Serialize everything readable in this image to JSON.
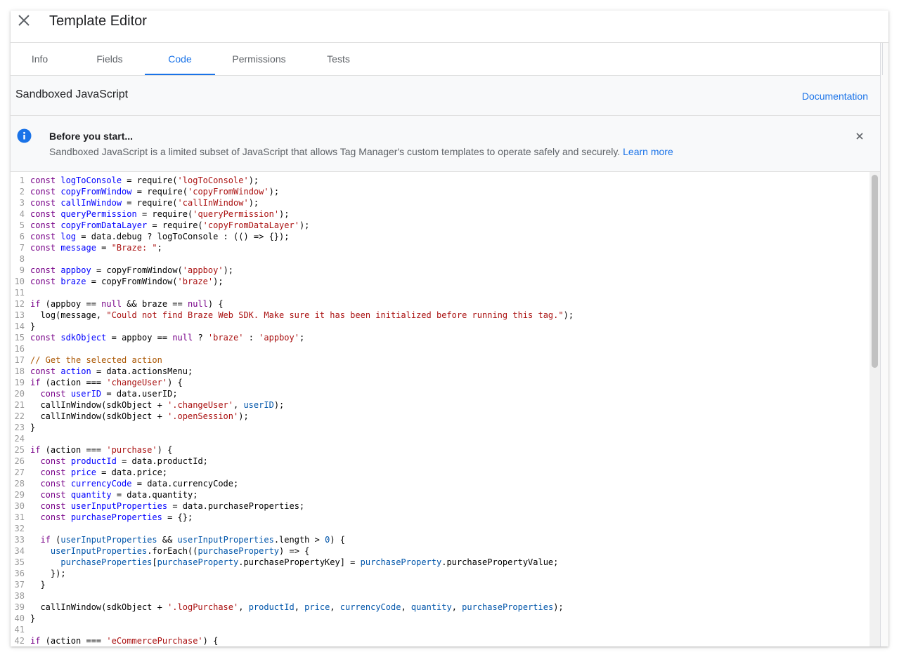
{
  "header": {
    "title": "Template Editor"
  },
  "tabs": [
    {
      "label": "Info",
      "active": false
    },
    {
      "label": "Fields",
      "active": false
    },
    {
      "label": "Code",
      "active": true
    },
    {
      "label": "Permissions",
      "active": false
    },
    {
      "label": "Tests",
      "active": false
    }
  ],
  "section": {
    "title": "Sandboxed JavaScript",
    "doc_link": "Documentation"
  },
  "notice": {
    "title": "Before you start...",
    "body": "Sandboxed JavaScript is a limited subset of JavaScript that allows Tag Manager's custom templates to operate safely and securely.",
    "learn_more": "Learn more"
  },
  "colors": {
    "accent": "#1a73e8",
    "keyword": "#770088",
    "def": "#0000ff",
    "string": "#aa1111",
    "comment": "#aa5500",
    "variable": "#0055aa"
  },
  "icons": {
    "close": "close-icon",
    "info": "info-icon",
    "dismiss": "close-icon"
  },
  "code": {
    "language": "javascript",
    "lines": [
      {
        "n": 1,
        "text": "const logToConsole = require('logToConsole');"
      },
      {
        "n": 2,
        "text": "const copyFromWindow = require('copyFromWindow');"
      },
      {
        "n": 3,
        "text": "const callInWindow = require('callInWindow');"
      },
      {
        "n": 4,
        "text": "const queryPermission = require('queryPermission');"
      },
      {
        "n": 5,
        "text": "const copyFromDataLayer = require('copyFromDataLayer');"
      },
      {
        "n": 6,
        "text": "const log = data.debug ? logToConsole : (() => {});"
      },
      {
        "n": 7,
        "text": "const message = \"Braze: \";"
      },
      {
        "n": 8,
        "text": ""
      },
      {
        "n": 9,
        "text": "const appboy = copyFromWindow('appboy');"
      },
      {
        "n": 10,
        "text": "const braze = copyFromWindow('braze');"
      },
      {
        "n": 11,
        "text": ""
      },
      {
        "n": 12,
        "text": "if (appboy == null && braze == null) {"
      },
      {
        "n": 13,
        "text": "  log(message, \"Could not find Braze Web SDK. Make sure it has been initialized before running this tag.\");"
      },
      {
        "n": 14,
        "text": "}"
      },
      {
        "n": 15,
        "text": "const sdkObject = appboy == null ? 'braze' : 'appboy';"
      },
      {
        "n": 16,
        "text": ""
      },
      {
        "n": 17,
        "text": "// Get the selected action"
      },
      {
        "n": 18,
        "text": "const action = data.actionsMenu;"
      },
      {
        "n": 19,
        "text": "if (action === 'changeUser') {"
      },
      {
        "n": 20,
        "text": "  const userID = data.userID;"
      },
      {
        "n": 21,
        "text": "  callInWindow(sdkObject + '.changeUser', userID);"
      },
      {
        "n": 22,
        "text": "  callInWindow(sdkObject + '.openSession');"
      },
      {
        "n": 23,
        "text": "}"
      },
      {
        "n": 24,
        "text": ""
      },
      {
        "n": 25,
        "text": "if (action === 'purchase') {"
      },
      {
        "n": 26,
        "text": "  const productId = data.productId;"
      },
      {
        "n": 27,
        "text": "  const price = data.price;"
      },
      {
        "n": 28,
        "text": "  const currencyCode = data.currencyCode;"
      },
      {
        "n": 29,
        "text": "  const quantity = data.quantity;"
      },
      {
        "n": 30,
        "text": "  const userInputProperties = data.purchaseProperties;"
      },
      {
        "n": 31,
        "text": "  const purchaseProperties = {};"
      },
      {
        "n": 32,
        "text": ""
      },
      {
        "n": 33,
        "text": "  if (userInputProperties && userInputProperties.length > 0) {"
      },
      {
        "n": 34,
        "text": "    userInputProperties.forEach((purchaseProperty) => {"
      },
      {
        "n": 35,
        "text": "      purchaseProperties[purchaseProperty.purchasePropertyKey] = purchaseProperty.purchasePropertyValue;"
      },
      {
        "n": 36,
        "text": "    });"
      },
      {
        "n": 37,
        "text": "  }"
      },
      {
        "n": 38,
        "text": ""
      },
      {
        "n": 39,
        "text": "  callInWindow(sdkObject + '.logPurchase', productId, price, currencyCode, quantity, purchaseProperties);"
      },
      {
        "n": 40,
        "text": "}"
      },
      {
        "n": 41,
        "text": ""
      },
      {
        "n": 42,
        "text": "if (action === 'eCommercePurchase') {"
      }
    ]
  }
}
